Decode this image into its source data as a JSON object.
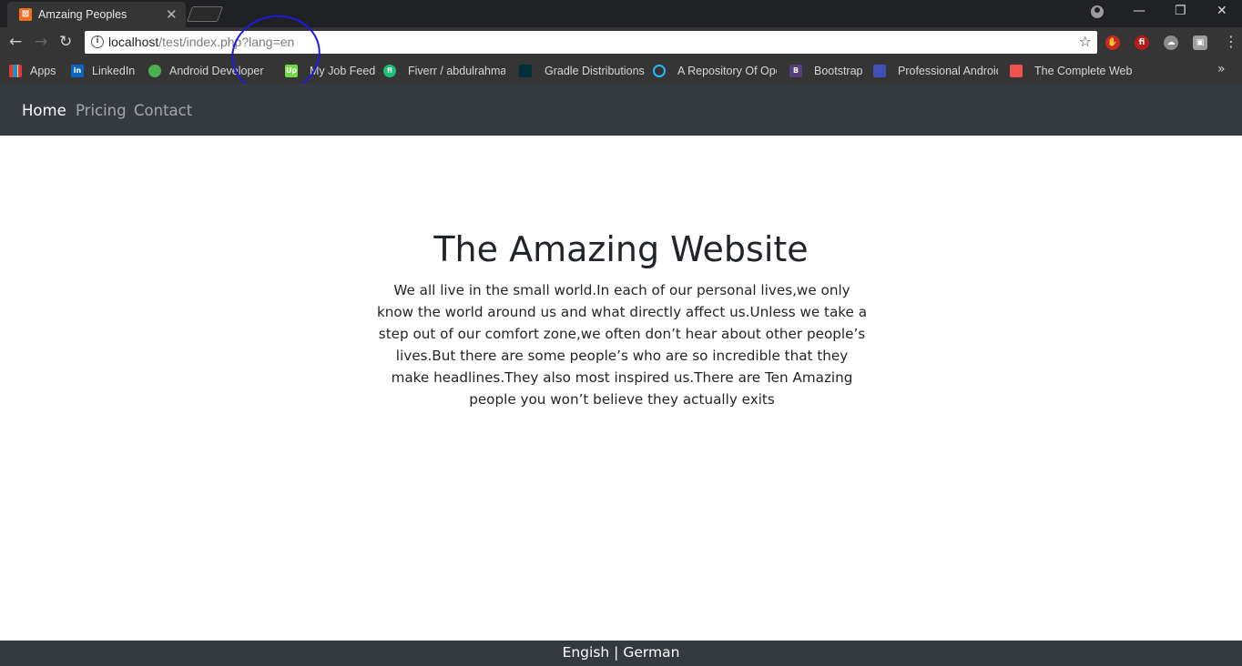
{
  "browser": {
    "tab_title": "Amzaing Peoples",
    "tab_close": "✕",
    "url_host": "localhost",
    "url_path": "/test/index.php?lang=en",
    "window_controls": {
      "minimize": "—",
      "restore": "❐",
      "close": "✕"
    },
    "nav": {
      "back": "←",
      "forward": "→",
      "reload": "↻",
      "star": "☆",
      "menu": "⋮",
      "info": "i"
    },
    "bookmarks": [
      {
        "label": "Apps",
        "icon": "apps-grid-icon"
      },
      {
        "label": "LinkedIn",
        "icon": "linkedin-icon"
      },
      {
        "label": "Android Developer J",
        "icon": "android-icon"
      },
      {
        "label": "My Job Feed",
        "icon": "upwork-icon"
      },
      {
        "label": "Fiverr / abdulrahman",
        "icon": "fiverr-icon"
      },
      {
        "label": "Gradle Distributions",
        "icon": "gradle-icon"
      },
      {
        "label": "A Repository Of Ope",
        "icon": "repository-icon"
      },
      {
        "label": "Bootstrap",
        "icon": "bootstrap-icon"
      },
      {
        "label": "Professional Android",
        "icon": "professional-android-icon"
      },
      {
        "label": "The Complete Web D",
        "icon": "complete-web-icon"
      }
    ],
    "bookmarks_more": "»"
  },
  "site": {
    "nav": {
      "home": "Home",
      "pricing": "Pricing",
      "contact": "Contact"
    },
    "hero": {
      "title": "The Amazing Website",
      "text": "We all live in the small world.In each of our personal lives,we only know the world around us and what directly affect us.Unless we take a step out of our comfort zone,we often don’t hear about other people’s lives.But there are some people’s who are so incredible that they make headlines.They also most inspired us.There are Ten Amazing people you won’t believe they actually exits"
    },
    "footer": {
      "english": "Engish",
      "separator": "|",
      "german": "German"
    }
  },
  "colors": {
    "navbar": "#343a40",
    "annotation": "#1c1ce0",
    "browser_frame": "#353535"
  }
}
